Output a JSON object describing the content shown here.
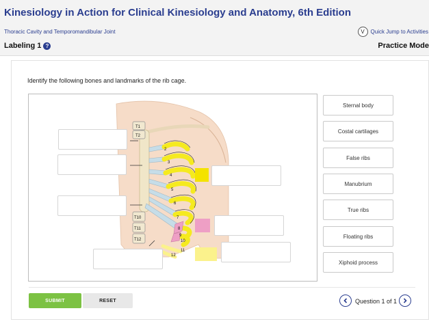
{
  "header": {
    "book_title": "Kinesiology in Action for Clinical Kinesiology and Anatomy, 6th Edition",
    "chapter": "Thoracic Cavity and Temporomandibular Joint",
    "quick_jump_key": "V",
    "quick_jump_label": "Quick Jump to Activities",
    "section_title": "Labeling 1",
    "help_glyph": "?",
    "mode": "Practice Mode"
  },
  "activity": {
    "instructions": "Identify the following bones and landmarks of the rib cage."
  },
  "figure": {
    "vertebra_labels": [
      "T1",
      "T2",
      "T10",
      "T11",
      "T12"
    ],
    "rib_numbers": [
      "2",
      "3",
      "4",
      "5",
      "6",
      "7",
      "8",
      "9",
      "10",
      "11",
      "12"
    ],
    "swatch_colors": {
      "yellow": "#f4e300",
      "pink": "#ee9fc5",
      "pale_yellow": "#fbf28c"
    },
    "rib_color": "#f5ea1f",
    "cartilage_color": "#c6dde8",
    "skin_color": "#f6dcc8"
  },
  "choices": [
    "Sternal body",
    "Costal cartilages",
    "False ribs",
    "Manubrium",
    "True ribs",
    "Floating ribs",
    "Xiphoid process"
  ],
  "controls": {
    "submit_label": "SUBMIT",
    "reset_label": "RESET",
    "question_label": "Question 1 of 1"
  },
  "colors": {
    "brand_blue": "#2a3d8f",
    "submit_green": "#7cc243"
  }
}
